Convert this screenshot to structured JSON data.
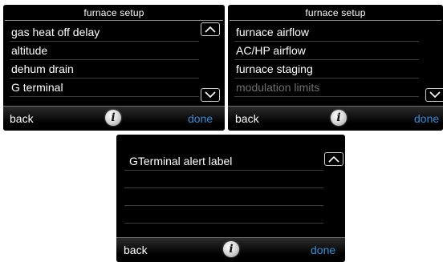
{
  "screens": [
    {
      "title": "furnace setup",
      "items": [
        {
          "label": "gas heat off delay"
        },
        {
          "label": "altitude"
        },
        {
          "label": "dehum drain"
        },
        {
          "label": "G terminal"
        }
      ],
      "back_label": "back",
      "done_label": "done",
      "info_label": "i"
    },
    {
      "title": "furnace setup",
      "items": [
        {
          "label": "furnace airflow"
        },
        {
          "label": "AC/HP airflow"
        },
        {
          "label": "furnace staging"
        },
        {
          "label": "modulation limits",
          "disabled": true
        }
      ],
      "back_label": "back",
      "done_label": "done",
      "info_label": "i"
    },
    {
      "title": "",
      "items": [
        {
          "label": "GTerminal alert label"
        }
      ],
      "back_label": "back",
      "done_label": "done",
      "info_label": "i"
    }
  ],
  "icons": {
    "scroll_up": "chevron-up-icon",
    "scroll_down": "chevron-down-icon",
    "info": "info-icon"
  },
  "colors": {
    "screen_bg": "#000000",
    "text": "#ffffff",
    "disabled_text": "#6f6f6f",
    "done_accent": "#2f8ed9"
  }
}
